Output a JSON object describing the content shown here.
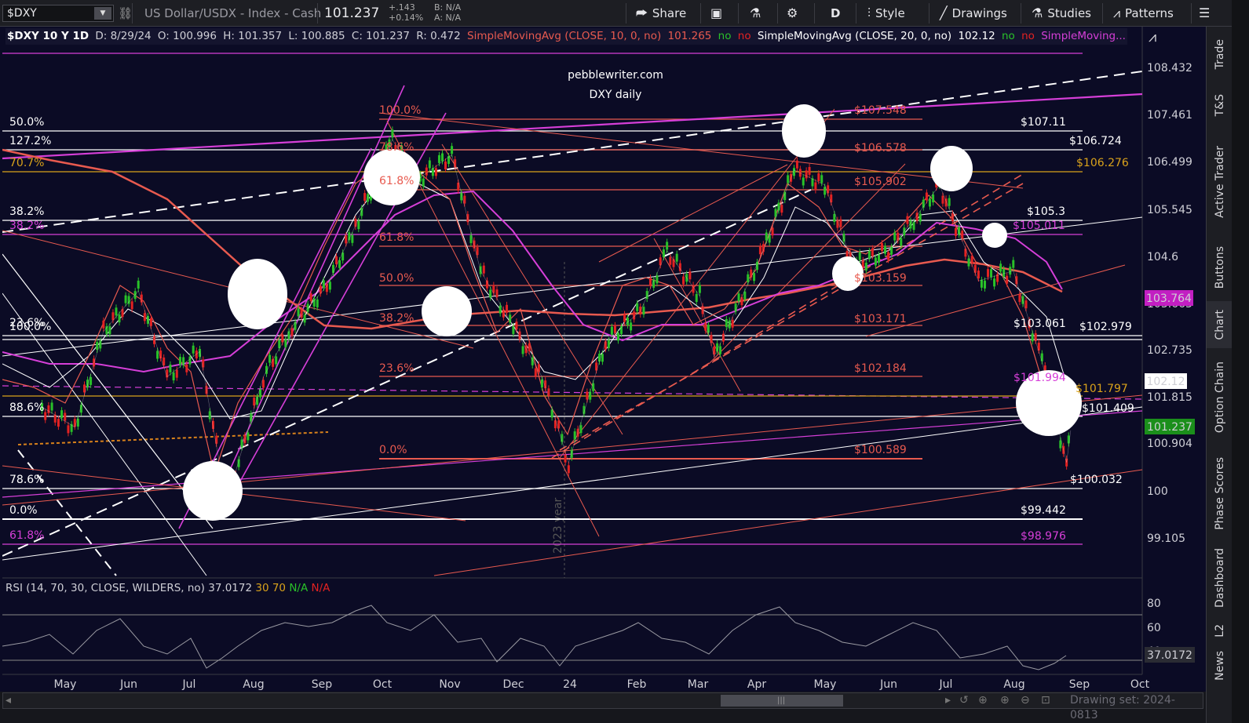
{
  "toolbar": {
    "symbol": "$DXY",
    "description": "US Dollar/USDX - Index - Cash",
    "last_price": "101.237",
    "net_change": "+.143",
    "pct_change": "+0.14%",
    "bid": "B: N/A",
    "ask": "A: N/A",
    "share_label": "Share",
    "period_label": "D",
    "style_label": "Style",
    "drawings_label": "Drawings",
    "studies_label": "Studies",
    "patterns_label": "Patterns"
  },
  "chart_header": {
    "title": "$DXY 10 Y 1D",
    "date": "D: 8/29/24",
    "open": "O: 100.996",
    "high": "H: 101.357",
    "low": "L: 100.885",
    "close": "C: 101.237",
    "range": "R: 0.472",
    "sma10_label": "SimpleMovingAvg (CLOSE, 10, 0, no)",
    "sma10_value": "101.265",
    "sma10_no1": "no",
    "sma10_no2": "no",
    "sma20_label": "SimpleMovingAvg (CLOSE, 20, 0, no)",
    "sma20_value": "102.12",
    "sma20_no1": "no",
    "sma20_no2": "no",
    "sma_more_label": "SimpleMoving..."
  },
  "watermark": {
    "line1": "pebblewriter.com",
    "line2": "DXY daily"
  },
  "rsi_header": {
    "label": "RSI (14, 70, 30, CLOSE, WILDERS, no)",
    "value": "37.0172",
    "overbought": "30",
    "oversold": "70",
    "na1": "N/A",
    "na2": "N/A"
  },
  "rsi_badge": "37.0172",
  "rsi_axis": [
    "80",
    "60",
    "40"
  ],
  "price_badges": {
    "sma_magenta": "103.764",
    "sma20": "102.12",
    "last": "101.237"
  },
  "sidebar": {
    "items": [
      "Trade",
      "T&S",
      "Active Trader",
      "Buttons",
      "Chart",
      "Option Chain",
      "Phase Scores",
      "Dashboard",
      "L2",
      "News"
    ],
    "active": "Chart"
  },
  "footer": {
    "drawing_set": "Drawing set: 2024-0813",
    "year_marker": "2023 year"
  },
  "colors": {
    "background": "#0b0b25",
    "fib_salmon": "#e85a4f",
    "magenta": "#d63fd8",
    "white": "#ffffff",
    "gold": "#d9a21b",
    "up_candle": "#29c129",
    "down_candle": "#e32222",
    "last_badge": "#1b8f1b",
    "sma_badge": "#c21fc2"
  },
  "chart_data": {
    "type": "line",
    "series": [
      {
        "name": "$DXY",
        "x": [
          "2023-04-15",
          "2023-05-01",
          "2023-05-15",
          "2023-06-01",
          "2023-06-15",
          "2023-07-01",
          "2023-07-14",
          "2023-08-01",
          "2023-08-15",
          "2023-09-01",
          "2023-09-15",
          "2023-10-03",
          "2023-10-15",
          "2023-11-01",
          "2023-11-15",
          "2023-12-01",
          "2023-12-15",
          "2023-12-28",
          "2024-01-15",
          "2024-02-01",
          "2024-02-14",
          "2024-03-01",
          "2024-03-08",
          "2024-04-01",
          "2024-04-16",
          "2024-05-01",
          "2024-05-15",
          "2024-06-01",
          "2024-06-15",
          "2024-06-26",
          "2024-07-15",
          "2024-08-01",
          "2024-08-15",
          "2024-08-27",
          "2024-08-29"
        ],
        "values": [
          101.7,
          101.3,
          103.2,
          104.0,
          102.3,
          102.8,
          99.8,
          102.3,
          103.3,
          104.1,
          105.3,
          107.0,
          106.2,
          106.7,
          104.4,
          103.3,
          102.3,
          100.6,
          103.0,
          103.6,
          104.8,
          103.9,
          102.7,
          104.8,
          106.4,
          106.1,
          104.5,
          104.8,
          105.5,
          106.1,
          104.2,
          104.4,
          102.6,
          100.6,
          101.237
        ]
      }
    ],
    "price_axis_labels": [
      "108.432",
      "107.461",
      "106.499",
      "105.545",
      "104.6",
      "103.663",
      "102.735",
      "101.815",
      "100.904",
      "100",
      "99.105"
    ],
    "month_labels": [
      "May",
      "Jun",
      "Jul",
      "Aug",
      "Sep",
      "Oct",
      "Nov",
      "Dec",
      "24",
      "Feb",
      "Mar",
      "Apr",
      "May",
      "Jun",
      "Jul",
      "Aug",
      "Sep",
      "Oct"
    ],
    "fib_left_labels": [
      {
        "text": "50.0%",
        "color": "#ffffff"
      },
      {
        "text": "127.2%",
        "color": "#ffffff"
      },
      {
        "text": "70.7%",
        "color": "#d9a21b"
      },
      {
        "text": "38.2%",
        "color": "#ffffff"
      },
      {
        "text": "38.2%",
        "color": "#d63fd8"
      },
      {
        "text": "23.6%",
        "color": "#ffffff"
      },
      {
        "text": "100.0%",
        "color": "#ffffff"
      },
      {
        "text": "88.6%",
        "color": "#ffffff"
      },
      {
        "text": "78.6%",
        "color": "#ffffff"
      },
      {
        "text": "0.0%",
        "color": "#ffffff"
      },
      {
        "text": "61.8%",
        "color": "#d63fd8"
      }
    ],
    "fib_mid_labels": [
      "100.0%",
      "78.6%",
      "61.8%",
      "61.8%",
      "50.0%",
      "38.2%",
      "23.6%",
      "0.0%"
    ],
    "level_labels": [
      {
        "text": "$107.548",
        "color": "#e85a4f"
      },
      {
        "text": "$106.578",
        "color": "#e85a4f"
      },
      {
        "text": "$105.902",
        "color": "#e85a4f"
      },
      {
        "text": "$103.159",
        "color": "#e85a4f"
      },
      {
        "text": "$103.171",
        "color": "#e85a4f"
      },
      {
        "text": "$102.184",
        "color": "#e85a4f"
      },
      {
        "text": "$100.589",
        "color": "#e85a4f"
      },
      {
        "text": "$107.11",
        "color": "#ffffff"
      },
      {
        "text": "$106.724",
        "color": "#ffffff"
      },
      {
        "text": "$106.276",
        "color": "#d9a21b"
      },
      {
        "text": "$105.3",
        "color": "#ffffff"
      },
      {
        "text": "$105.011",
        "color": "#d63fd8"
      },
      {
        "text": "$103.061",
        "color": "#ffffff"
      },
      {
        "text": "$102.979",
        "color": "#ffffff"
      },
      {
        "text": "$101.994",
        "color": "#d63fd8"
      },
      {
        "text": "$101.797",
        "color": "#d9a21b"
      },
      {
        "text": "$101.409",
        "color": "#ffffff"
      },
      {
        "text": "$100.032",
        "color": "#ffffff"
      },
      {
        "text": "$99.442",
        "color": "#ffffff"
      },
      {
        "text": "$98.976",
        "color": "#d63fd8"
      }
    ]
  }
}
